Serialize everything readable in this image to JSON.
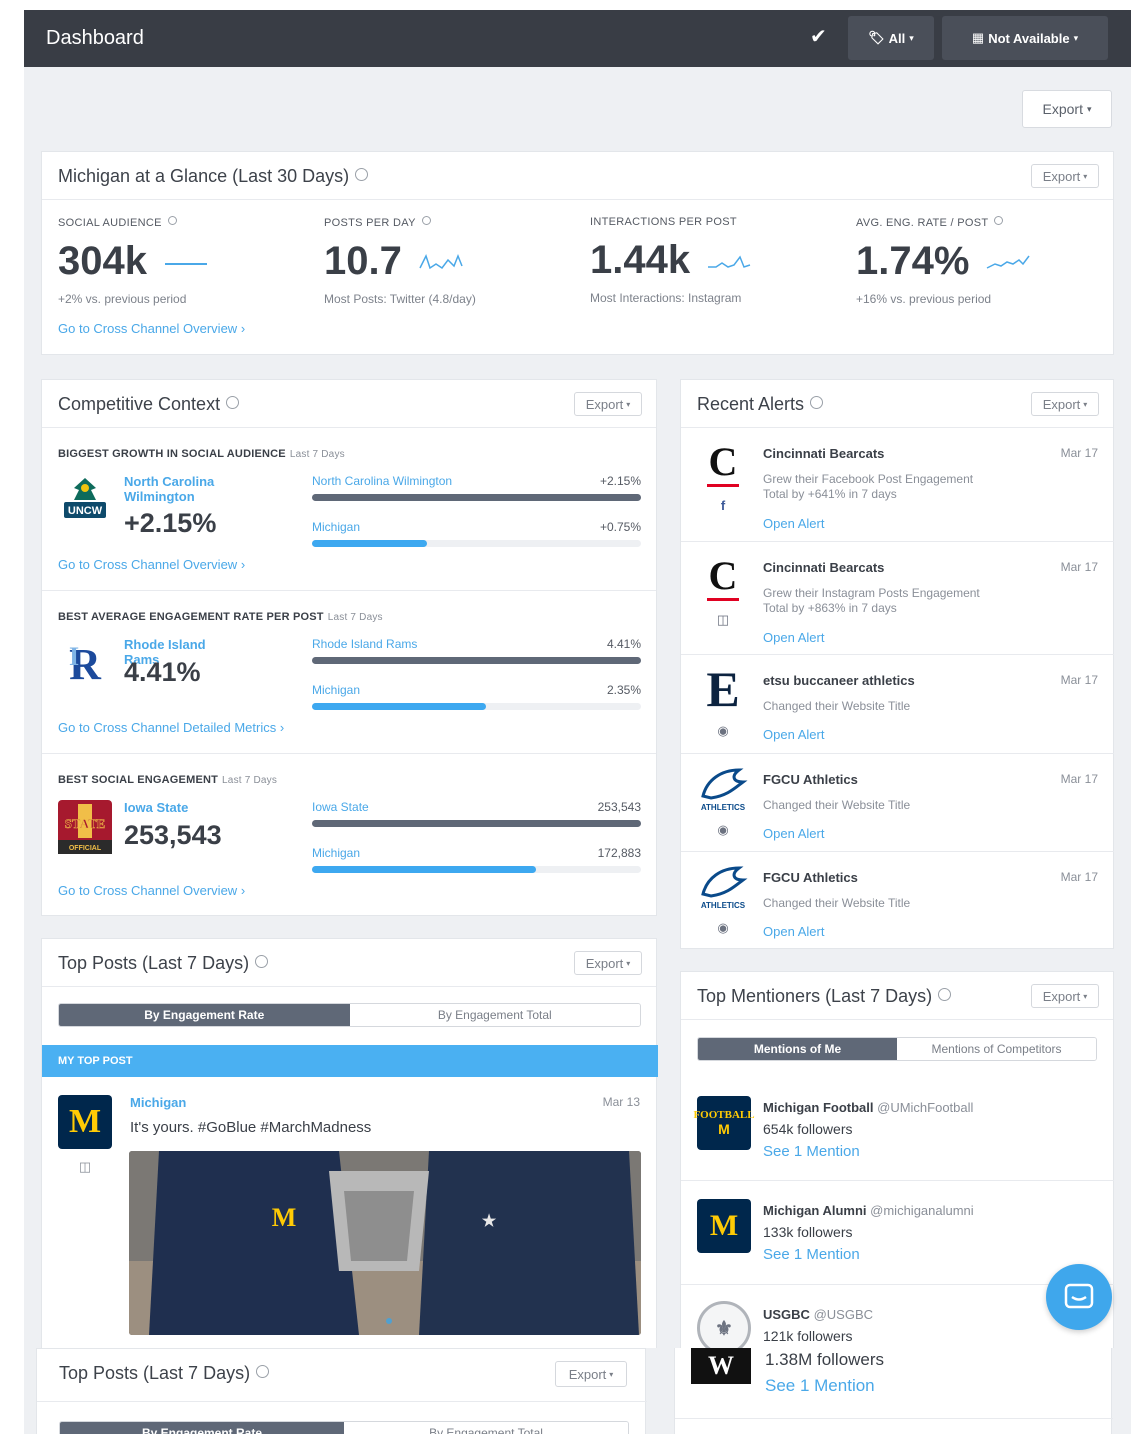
{
  "header": {
    "title": "Dashboard",
    "filter_all": "All",
    "date_range": "Not Available"
  },
  "export_label": "Export",
  "glance": {
    "title": "Michigan at a Glance (Last 30 Days)",
    "metrics": [
      {
        "label": "SOCIAL AUDIENCE",
        "value": "304k",
        "sub": "+2% vs. previous period"
      },
      {
        "label": "POSTS PER DAY",
        "value": "10.7",
        "sub": "Most Posts: Twitter (4.8/day)"
      },
      {
        "label": "INTERACTIONS PER POST",
        "value": "1.44k",
        "sub": "Most Interactions: Instagram"
      },
      {
        "label": "AVG. ENG. RATE / POST",
        "value": "1.74%",
        "sub": "+16% vs. previous period"
      }
    ],
    "link": "Go to Cross Channel Overview"
  },
  "competitive": {
    "title": "Competitive Context",
    "sections": [
      {
        "label": "BIGGEST GROWTH IN SOCIAL AUDIENCE",
        "period": "Last 7 Days",
        "team": "North Carolina Wilmington",
        "value": "+2.15%",
        "bar1_name": "North Carolina Wilmington",
        "bar1_value": "+2.15%",
        "bar1_frac": 1.0,
        "bar2_name": "Michigan",
        "bar2_value": "+0.75%",
        "bar2_frac": 0.35,
        "link": "Go to Cross Channel Overview"
      },
      {
        "label": "BEST AVERAGE ENGAGEMENT RATE PER POST",
        "period": "Last 7 Days",
        "team": "Rhode Island Rams",
        "value": "4.41%",
        "bar1_name": "Rhode Island Rams",
        "bar1_value": "4.41%",
        "bar1_frac": 1.0,
        "bar2_name": "Michigan",
        "bar2_value": "2.35%",
        "bar2_frac": 0.53,
        "link": "Go to Cross Channel Detailed Metrics"
      },
      {
        "label": "BEST SOCIAL ENGAGEMENT",
        "period": "Last 7 Days",
        "team": "Iowa State",
        "value": "253,543",
        "bar1_name": "Iowa State",
        "bar1_value": "253,543",
        "bar1_frac": 1.0,
        "bar2_name": "Michigan",
        "bar2_value": "172,883",
        "bar2_frac": 0.68,
        "link": "Go to Cross Channel Overview"
      }
    ]
  },
  "alerts": {
    "title": "Recent Alerts",
    "items": [
      {
        "name": "Cincinnati Bearcats",
        "date": "Mar 17",
        "desc1": "Grew their Facebook Post Engagement",
        "desc2": "Total by +641% in 7 days",
        "link": "Open Alert"
      },
      {
        "name": "Cincinnati Bearcats",
        "date": "Mar 17",
        "desc1": "Grew their Instagram Posts Engagement",
        "desc2": "Total by +863% in 7 days",
        "link": "Open Alert"
      },
      {
        "name": "etsu buccaneer athletics",
        "date": "Mar 17",
        "desc1": "Changed their Website Title",
        "link": "Open Alert"
      },
      {
        "name": "FGCU Athletics",
        "date": "Mar 17",
        "desc1": "Changed their Website Title",
        "link": "Open Alert"
      },
      {
        "name": "FGCU Athletics",
        "date": "Mar 17",
        "desc1": "Changed their Website Title",
        "link": "Open Alert"
      }
    ]
  },
  "top_posts": {
    "title": "Top Posts (Last 7 Days)",
    "tab1": "By Engagement Rate",
    "tab2": "By Engagement Total",
    "my_top_post": "MY TOP POST",
    "post_author": "Michigan",
    "post_date": "Mar 13",
    "post_text": "It's yours. #GoBlue #MarchMadness"
  },
  "mentioners": {
    "title": "Top Mentioners (Last 7 Days)",
    "tab1": "Mentions of Me",
    "tab2": "Mentions of Competitors",
    "items": [
      {
        "name": "Michigan Football",
        "handle": "@UMichFootball",
        "followers": "654k followers",
        "link": "See 1 Mention"
      },
      {
        "name": "Michigan Alumni",
        "handle": "@michiganalumni",
        "followers": "133k followers",
        "link": "See 1 Mention"
      },
      {
        "name": "USGBC",
        "handle": "@USGBC",
        "followers": "121k followers"
      }
    ],
    "extra_followers": "1.38M followers",
    "extra_link": "See 1 Mention"
  },
  "icons": [
    "check-icon",
    "tag-icon",
    "calendar-icon",
    "info-icon",
    "facebook-icon",
    "instagram-icon",
    "globe-icon",
    "chat-icon"
  ]
}
